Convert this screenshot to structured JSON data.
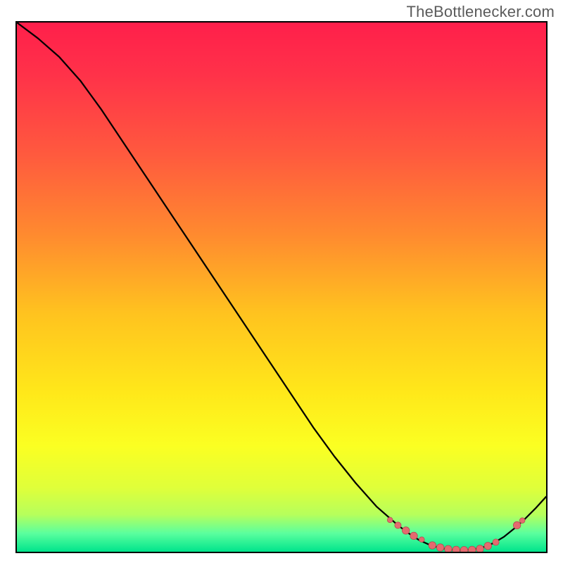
{
  "watermark": "TheBottlenecker.com",
  "colors": {
    "border": "#000000",
    "curve": "#000000",
    "marker_fill": "#e46a6f",
    "marker_stroke": "#b24a4f",
    "gradient_stops": [
      {
        "offset": 0.0,
        "color": "#ff1f4b"
      },
      {
        "offset": 0.1,
        "color": "#ff3249"
      },
      {
        "offset": 0.25,
        "color": "#ff5a3e"
      },
      {
        "offset": 0.4,
        "color": "#ff8a2f"
      },
      {
        "offset": 0.55,
        "color": "#ffc31f"
      },
      {
        "offset": 0.7,
        "color": "#ffe81a"
      },
      {
        "offset": 0.8,
        "color": "#fbff22"
      },
      {
        "offset": 0.88,
        "color": "#dfff3a"
      },
      {
        "offset": 0.93,
        "color": "#b6ff5c"
      },
      {
        "offset": 0.965,
        "color": "#5bff9e"
      },
      {
        "offset": 1.0,
        "color": "#00e48c"
      }
    ]
  },
  "chart_data": {
    "type": "line",
    "title": "",
    "xlabel": "",
    "ylabel": "",
    "xlim": [
      0,
      100
    ],
    "ylim": [
      0,
      100
    ],
    "curve": {
      "name": "bottleneck-curve",
      "x": [
        0,
        4,
        8,
        12,
        16,
        20,
        24,
        28,
        32,
        36,
        40,
        44,
        48,
        52,
        56,
        60,
        64,
        68,
        72,
        74,
        76,
        78,
        80,
        82,
        84,
        86,
        88,
        90,
        92,
        94,
        96,
        98,
        100
      ],
      "y": [
        100,
        97.0,
        93.5,
        89.0,
        83.5,
        77.5,
        71.5,
        65.5,
        59.5,
        53.5,
        47.5,
        41.5,
        35.5,
        29.5,
        23.5,
        18.0,
        13.0,
        8.5,
        5.0,
        3.5,
        2.2,
        1.3,
        0.7,
        0.4,
        0.3,
        0.4,
        0.8,
        1.6,
        2.8,
        4.4,
        6.2,
        8.2,
        10.4
      ]
    },
    "markers": {
      "name": "highlight-points",
      "points": [
        {
          "x": 70.5,
          "y": 6.0,
          "r": 3.2
        },
        {
          "x": 72.0,
          "y": 5.0,
          "r": 3.8
        },
        {
          "x": 73.5,
          "y": 4.0,
          "r": 4.4
        },
        {
          "x": 75.0,
          "y": 3.0,
          "r": 4.4
        },
        {
          "x": 76.5,
          "y": 2.3,
          "r": 3.2
        },
        {
          "x": 78.5,
          "y": 1.2,
          "r": 4.4
        },
        {
          "x": 80.0,
          "y": 0.8,
          "r": 4.4
        },
        {
          "x": 81.5,
          "y": 0.5,
          "r": 4.4
        },
        {
          "x": 83.0,
          "y": 0.35,
          "r": 4.4
        },
        {
          "x": 84.5,
          "y": 0.3,
          "r": 4.4
        },
        {
          "x": 86.0,
          "y": 0.35,
          "r": 4.4
        },
        {
          "x": 87.5,
          "y": 0.55,
          "r": 4.4
        },
        {
          "x": 89.0,
          "y": 1.1,
          "r": 4.4
        },
        {
          "x": 90.5,
          "y": 1.8,
          "r": 3.8
        },
        {
          "x": 94.5,
          "y": 5.0,
          "r": 4.4
        },
        {
          "x": 95.5,
          "y": 5.9,
          "r": 3.2
        }
      ]
    }
  }
}
